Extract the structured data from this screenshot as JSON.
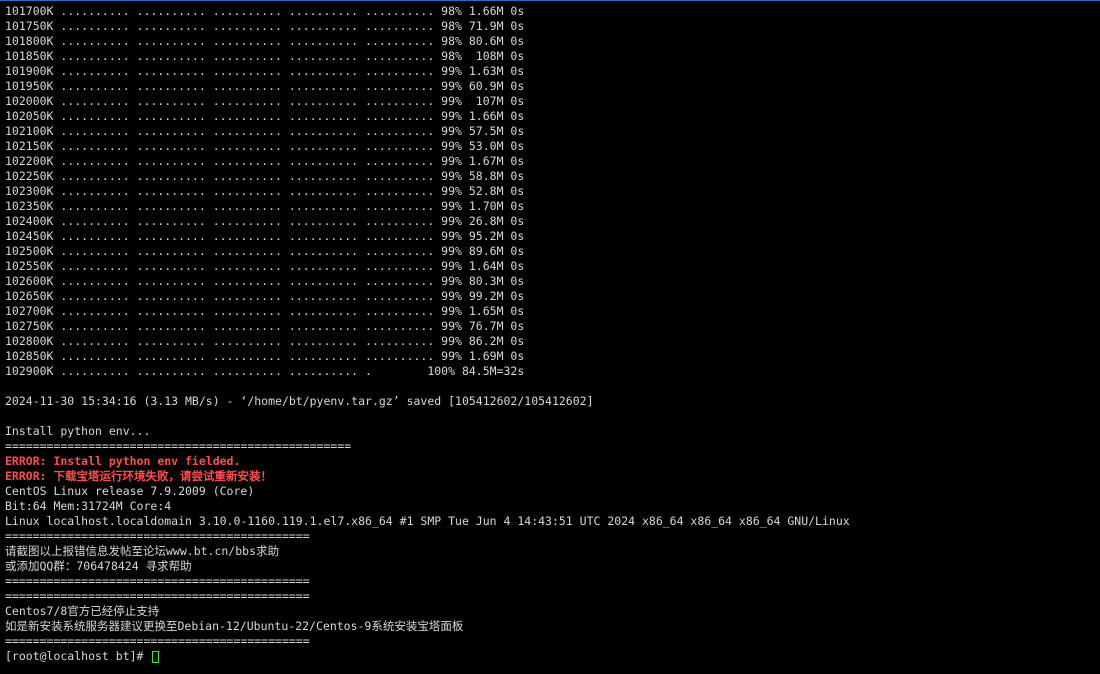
{
  "terminal": {
    "lines": [
      {
        "text": "101700K .......... .......... .......... .......... .......... 98% 1.66M 0s",
        "type": "normal"
      },
      {
        "text": "101750K .......... .......... .......... .......... .......... 98% 71.9M 0s",
        "type": "normal"
      },
      {
        "text": "101800K .......... .......... .......... .......... .......... 98% 80.6M 0s",
        "type": "normal"
      },
      {
        "text": "101850K .......... .......... .......... .......... .......... 98%  108M 0s",
        "type": "normal"
      },
      {
        "text": "101900K .......... .......... .......... .......... .......... 99% 1.63M 0s",
        "type": "normal"
      },
      {
        "text": "101950K .......... .......... .......... .......... .......... 99% 60.9M 0s",
        "type": "normal"
      },
      {
        "text": "102000K .......... .......... .......... .......... .......... 99%  107M 0s",
        "type": "normal"
      },
      {
        "text": "102050K .......... .......... .......... .......... .......... 99% 1.66M 0s",
        "type": "normal"
      },
      {
        "text": "102100K .......... .......... .......... .......... .......... 99% 57.5M 0s",
        "type": "normal"
      },
      {
        "text": "102150K .......... .......... .......... .......... .......... 99% 53.0M 0s",
        "type": "normal"
      },
      {
        "text": "102200K .......... .......... .......... .......... .......... 99% 1.67M 0s",
        "type": "normal"
      },
      {
        "text": "102250K .......... .......... .......... .......... .......... 99% 58.8M 0s",
        "type": "normal"
      },
      {
        "text": "102300K .......... .......... .......... .......... .......... 99% 52.8M 0s",
        "type": "normal"
      },
      {
        "text": "102350K .......... .......... .......... .......... .......... 99% 1.70M 0s",
        "type": "normal"
      },
      {
        "text": "102400K .......... .......... .......... .......... .......... 99% 26.8M 0s",
        "type": "normal"
      },
      {
        "text": "102450K .......... .......... .......... .......... .......... 99% 95.2M 0s",
        "type": "normal"
      },
      {
        "text": "102500K .......... .......... .......... .......... .......... 99% 89.6M 0s",
        "type": "normal"
      },
      {
        "text": "102550K .......... .......... .......... .......... .......... 99% 1.64M 0s",
        "type": "normal"
      },
      {
        "text": "102600K .......... .......... .......... .......... .......... 99% 80.3M 0s",
        "type": "normal"
      },
      {
        "text": "102650K .......... .......... .......... .......... .......... 99% 99.2M 0s",
        "type": "normal"
      },
      {
        "text": "102700K .......... .......... .......... .......... .......... 99% 1.65M 0s",
        "type": "normal"
      },
      {
        "text": "102750K .......... .......... .......... .......... .......... 99% 76.7M 0s",
        "type": "normal"
      },
      {
        "text": "102800K .......... .......... .......... .......... .......... 99% 86.2M 0s",
        "type": "normal"
      },
      {
        "text": "102850K .......... .......... .......... .......... .......... 99% 1.69M 0s",
        "type": "normal"
      },
      {
        "text": "102900K .......... .......... .......... .......... .        100% 84.5M=32s",
        "type": "normal"
      },
      {
        "text": "",
        "type": "normal"
      },
      {
        "text": "2024-11-30 15:34:16 (3.13 MB/s) - ‘/home/bt/pyenv.tar.gz’ saved [105412602/105412602]",
        "type": "normal"
      },
      {
        "text": "",
        "type": "normal"
      },
      {
        "text": "Install python env...",
        "type": "normal"
      },
      {
        "text": "==================================================",
        "type": "normal"
      },
      {
        "text": "ERROR: Install python env fielded.",
        "type": "error"
      },
      {
        "text": "ERROR: 下载宝塔运行环境失败，请尝试重新安装！",
        "type": "error"
      },
      {
        "text": "CentOS Linux release 7.9.2009 (Core)",
        "type": "normal"
      },
      {
        "text": "Bit:64 Mem:31724M Core:4",
        "type": "normal"
      },
      {
        "text": "Linux localhost.localdomain 3.10.0-1160.119.1.el7.x86_64 #1 SMP Tue Jun 4 14:43:51 UTC 2024 x86_64 x86_64 x86_64 GNU/Linux",
        "type": "normal"
      },
      {
        "text": "============================================",
        "type": "normal"
      },
      {
        "text": "请截图以上报错信息发帖至论坛www.bt.cn/bbs求助",
        "type": "normal"
      },
      {
        "text": "或添加QQ群：706478424 寻求帮助",
        "type": "normal"
      },
      {
        "text": "============================================",
        "type": "normal"
      },
      {
        "text": "============================================",
        "type": "normal"
      },
      {
        "text": "Centos7/8官方已经停止支持",
        "type": "normal"
      },
      {
        "text": "如是新安装系统服务器建议更换至Debian-12/Ubuntu-22/Centos-9系统安装宝塔面板",
        "type": "normal"
      },
      {
        "text": "============================================",
        "type": "normal"
      }
    ],
    "prompt": "[root@localhost bt]# "
  },
  "colors": {
    "background": "#000000",
    "foreground": "#d8d8d8",
    "error": "#ff4d4d",
    "cursor": "#2ee82e",
    "window_border": "#1e6fd0"
  }
}
